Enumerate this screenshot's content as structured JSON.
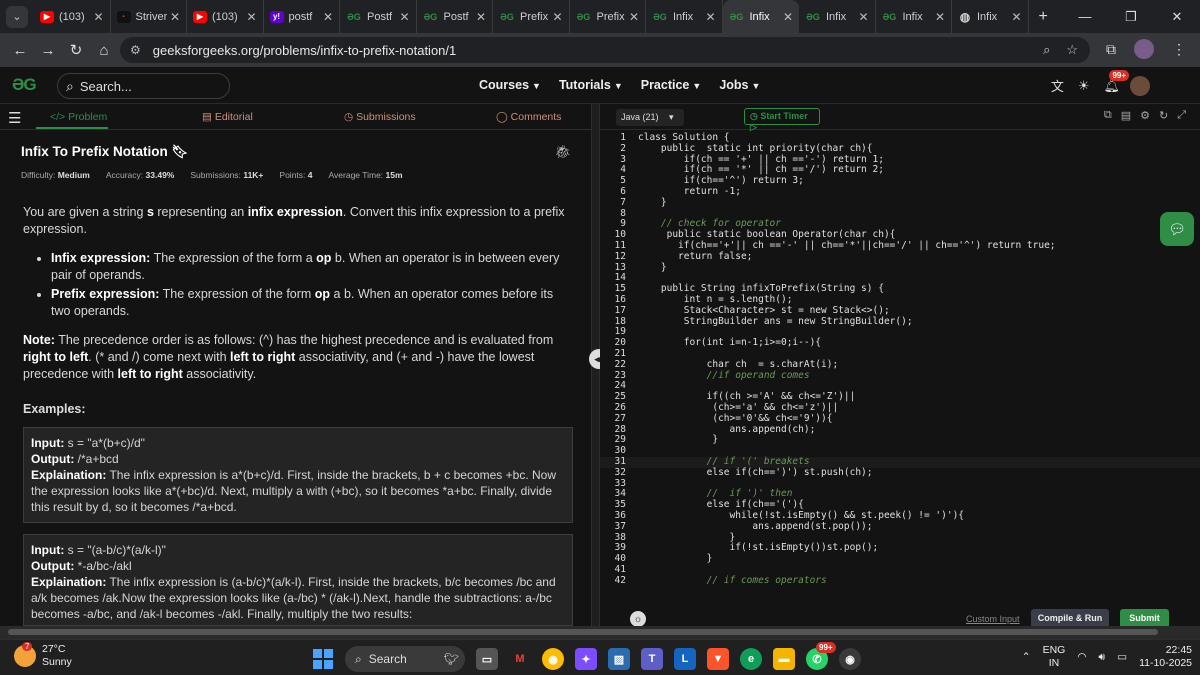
{
  "browser": {
    "tabs": [
      {
        "title": "(103)",
        "icon": "youtube-icon",
        "fav": "yt"
      },
      {
        "title": "Striver",
        "icon": "striver-icon",
        "fav": "st"
      },
      {
        "title": "(103)",
        "icon": "youtube-icon",
        "fav": "yt"
      },
      {
        "title": "postf",
        "icon": "yahoo-icon",
        "fav": "yh"
      },
      {
        "title": "Postf",
        "icon": "gfg-icon",
        "fav": "gg"
      },
      {
        "title": "Postf",
        "icon": "gfg-icon",
        "fav": "gg"
      },
      {
        "title": "Prefix",
        "icon": "gfg-icon",
        "fav": "gg"
      },
      {
        "title": "Prefix",
        "icon": "gfg-icon",
        "fav": "gg"
      },
      {
        "title": "Infix",
        "icon": "gfg-icon",
        "fav": "gg"
      },
      {
        "title": "Infix",
        "icon": "gfg-icon",
        "fav": "gg",
        "active": true
      },
      {
        "title": "Infix",
        "icon": "gfg-icon",
        "fav": "gg"
      },
      {
        "title": "Infix",
        "icon": "gfg-icon",
        "fav": "gg"
      },
      {
        "title": "Infix",
        "icon": "globe-icon",
        "fav": "gl"
      }
    ],
    "url": "geeksforgeeks.org/problems/infix-to-prefix-notation/1"
  },
  "header": {
    "search_placeholder": "Search...",
    "nav": [
      "Courses",
      "Tutorials",
      "Practice",
      "Jobs"
    ],
    "notif_badge": "99+"
  },
  "problem": {
    "tabs": {
      "problem": "Problem",
      "editorial": "Editorial",
      "submissions": "Submissions",
      "comments": "Comments"
    },
    "title": "Infix To Prefix Notation",
    "meta": {
      "difficulty_label": "Difficulty:",
      "difficulty": "Medium",
      "accuracy_label": "Accuracy:",
      "accuracy": "33.49%",
      "submissions_label": "Submissions:",
      "submissions": "11K+",
      "points_label": "Points:",
      "points": "4",
      "time_label": "Average Time:",
      "time": "15m"
    },
    "intro_1": "You are given a string ",
    "intro_s": "s",
    "intro_2": " representing an ",
    "intro_ie": "infix expression",
    "intro_3": ". Convert this infix expression to a prefix expression.",
    "b1_label": "Infix expression:",
    "b1_text_1": " The expression of the form a ",
    "b1_op": "op",
    "b1_text_2": " b. When an operator is in between every pair of operands.",
    "b2_label": "Prefix expression:",
    "b2_text_1": " The expression of the form ",
    "b2_op": "op",
    "b2_text_2": " a b. When an operator comes before its two operands.",
    "note_label": "Note:",
    "note_1": " The precedence order is as follows: (^) has the highest precedence and is evaluated from ",
    "note_rtl": "right to left",
    "note_2": ". (* and /) come next with ",
    "note_ltr1": "left to right",
    "note_3": " associativity, and (+ and -) have the lowest precedence with ",
    "note_ltr2": "left to right",
    "note_4": " associativity.",
    "examples_label": "Examples:",
    "examples": [
      {
        "input_label": "Input:",
        "input": " s = \"a*(b+c)/d\"",
        "output_label": "Output:",
        "output": " /*a+bcd",
        "expl_label": "Explaination:",
        "expl": " The infix expression is a*(b+c)/d. First, inside the brackets, b + c becomes +bc. Now the expression looks like a*(+bc)/d. Next, multiply a with (+bc), so it becomes *a+bc. Finally, divide this result by d, so it becomes /*a+bcd."
      },
      {
        "input_label": "Input:",
        "input": " s = \"(a-b/c)*(a/k-l)\"",
        "output_label": "Output:",
        "output": " *-a/bc-/akl",
        "expl_label": "Explaination:",
        "expl": " The infix expression is (a-b/c)*(a/k-l). First, inside the brackets, b/c becomes /bc and a/k becomes /ak.Now the expression looks like (a-/bc) * (/ak-l).Next, handle the subtractions: a-/bc becomes -a/bc, and /ak-l becomes -/akl. Finally, multiply the two results:"
      }
    ]
  },
  "editor": {
    "language": "Java (21)",
    "timer": "Start Timer",
    "custom_input": "Custom Input",
    "compile": "Compile & Run",
    "submit": "Submit",
    "lines": [
      "class Solution {",
      "    public  static int priority(char ch){",
      "        if(ch == '+' || ch =='-') return 1;",
      "        if(ch == '*' || ch =='/') return 2;",
      "        if(ch=='^') return 3;",
      "        return -1;",
      "    }",
      "",
      "    // check for operator",
      "     public static boolean Operator(char ch){",
      "       if(ch=='+'|| ch =='-' || ch=='*'||ch=='/' || ch=='^') return true;",
      "       return false;",
      "    }",
      "",
      "    public String infixToPrefix(String s) {",
      "        int n = s.length();",
      "        Stack<Character> st = new Stack<>();",
      "        StringBuilder ans = new StringBuilder();",
      "",
      "        for(int i=n-1;i>=0;i--){",
      "",
      "            char ch  = s.charAt(i);",
      "            //if operand comes",
      "",
      "            if((ch >='A' && ch<='Z')||",
      "             (ch>='a' && ch<='z')||",
      "             (ch>='0'&& ch<='9')){",
      "                ans.append(ch);",
      "             }",
      "",
      "            // if '(' breakets",
      "            else if(ch==')') st.push(ch);",
      "",
      "            //  if ')' then",
      "            else if(ch=='('){",
      "                while(!st.isEmpty() && st.peek() != ')'){",
      "                    ans.append(st.pop());",
      "                }",
      "                if(!st.isEmpty())st.pop();",
      "            }",
      "",
      "            // if comes operators"
    ],
    "line_numbers": [
      "1",
      "2",
      "3",
      "4",
      "5",
      "6",
      "7",
      "8",
      "9",
      "10",
      "11",
      "12",
      "13",
      "14",
      "15",
      "16",
      "17",
      "18",
      "19",
      "20",
      "21",
      "22",
      "23",
      "24",
      "25",
      "26",
      "27",
      "28",
      "29",
      "30",
      "31",
      "32",
      "33",
      "34",
      "35",
      "36",
      "37",
      "38",
      "39",
      "40",
      "41",
      "42"
    ]
  },
  "taskbar": {
    "weather_temp": "27°C",
    "weather_desc": "Sunny",
    "weather_badge": "7",
    "search": "Search",
    "lang_1": "ENG",
    "lang_2": "IN",
    "time": "22:45",
    "date": "11-10-2025",
    "whatsapp_badge": "99+"
  }
}
